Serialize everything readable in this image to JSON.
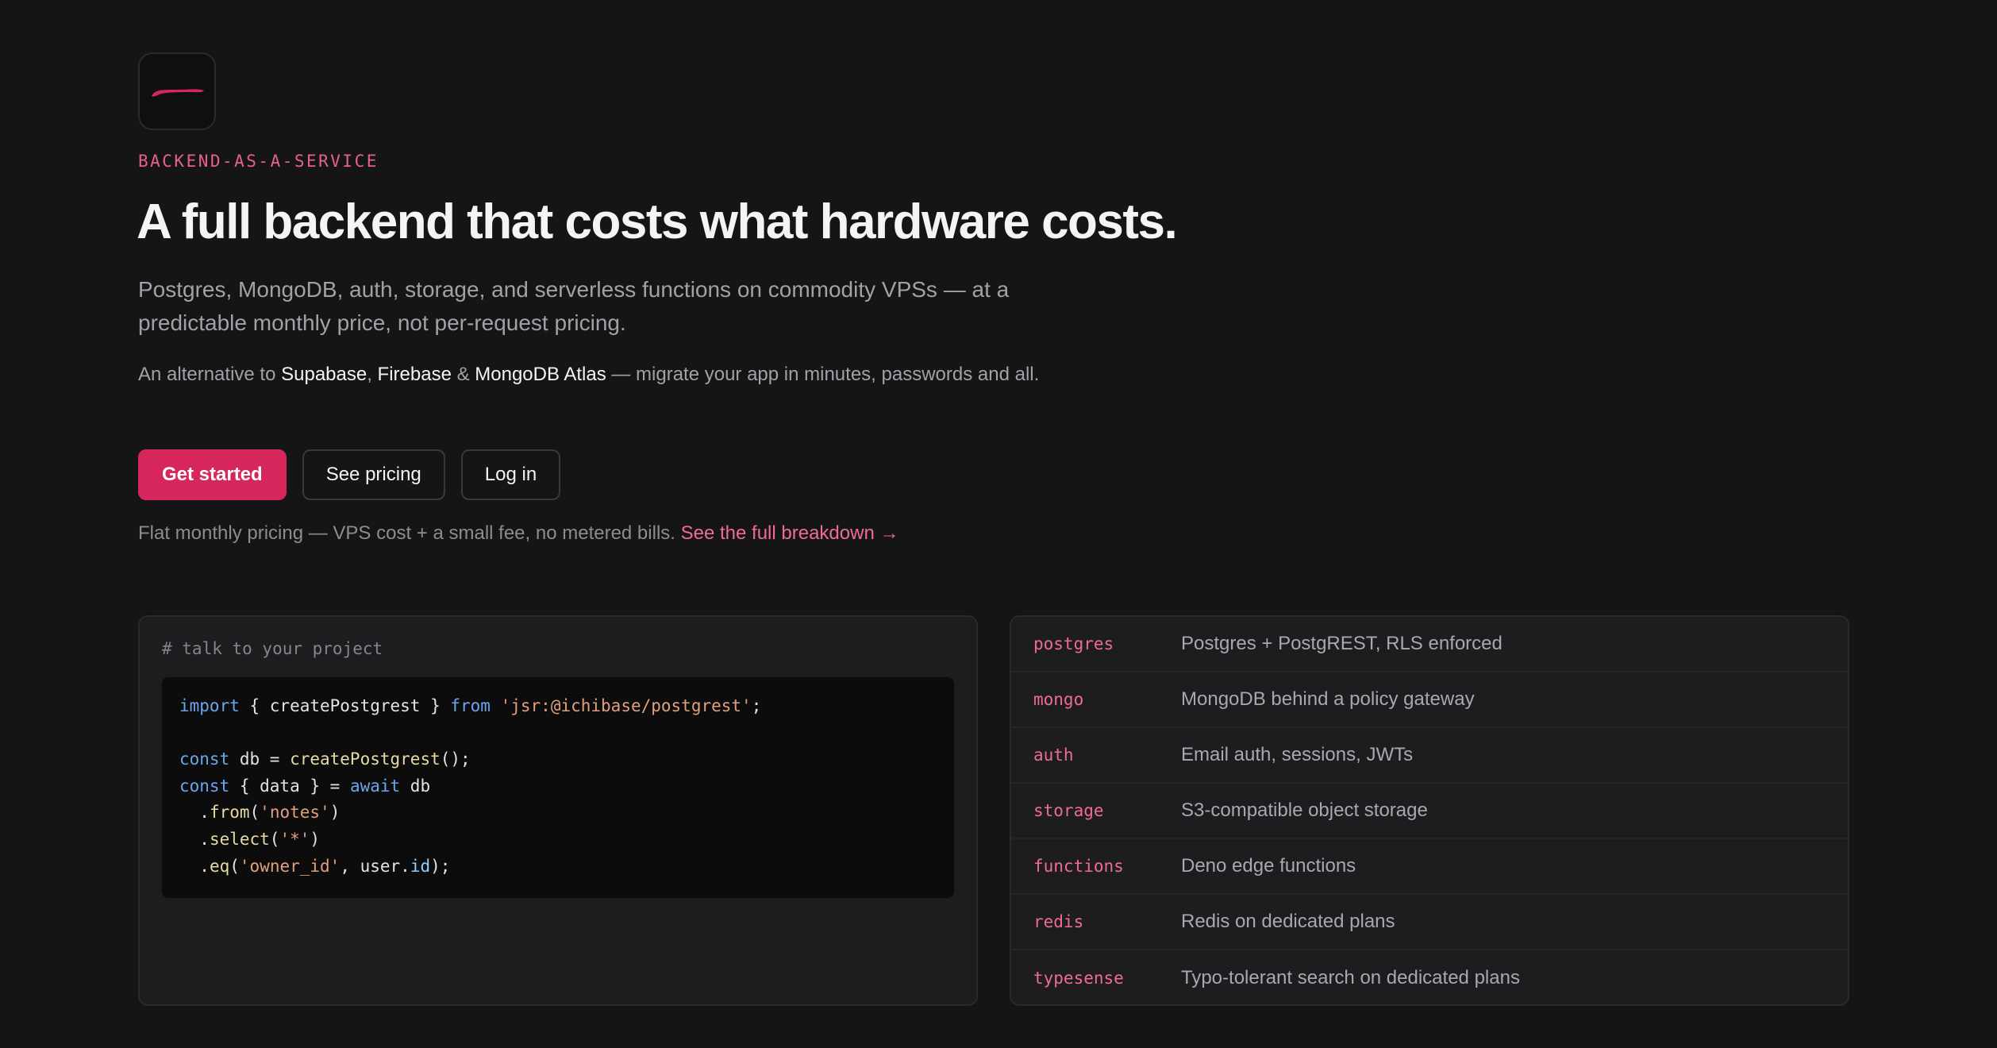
{
  "brand": {
    "logo_icon": "pink-brushstroke-logo",
    "accent": "#d6265c"
  },
  "hero": {
    "eyebrow": "BACKEND-AS-A-SERVICE",
    "headline": "A full backend that costs what hardware costs.",
    "lede": "Postgres, MongoDB, auth, storage, and serverless functions on commodity VPSs — at a predictable monthly price, not per-request pricing.",
    "alt": {
      "prefix": "An alternative to ",
      "supabase": "Supabase",
      "sep1": ", ",
      "firebase": "Firebase",
      "sep2": " & ",
      "mongodb_atlas": "MongoDB Atlas",
      "suffix": " — migrate your app in minutes, passwords and all."
    }
  },
  "actions": {
    "get_started": "Get started",
    "see_pricing": "See pricing",
    "log_in": "Log in"
  },
  "pricing_note": {
    "text": "Flat monthly pricing — VPS cost + a small fee, no metered bills. ",
    "link": "See the full breakdown →"
  },
  "code": {
    "comment": "# talk to your project",
    "lines": [
      [
        {
          "t": "import",
          "c": "kw"
        },
        {
          "t": " { createPostgrest } "
        },
        {
          "t": "from",
          "c": "kw"
        },
        {
          "t": " "
        },
        {
          "t": "'jsr:@ichibase/postgrest'",
          "c": "str"
        },
        {
          "t": ";"
        }
      ],
      [],
      [
        {
          "t": "const",
          "c": "kw"
        },
        {
          "t": " db = "
        },
        {
          "t": "createPostgrest",
          "c": "fn"
        },
        {
          "t": "();"
        }
      ],
      [
        {
          "t": "const",
          "c": "kw"
        },
        {
          "t": " { data } = "
        },
        {
          "t": "await",
          "c": "kw"
        },
        {
          "t": " db"
        }
      ],
      [
        {
          "t": "  ."
        },
        {
          "t": "from",
          "c": "fn"
        },
        {
          "t": "("
        },
        {
          "t": "'notes'",
          "c": "str"
        },
        {
          "t": ")"
        }
      ],
      [
        {
          "t": "  ."
        },
        {
          "t": "select",
          "c": "fn"
        },
        {
          "t": "("
        },
        {
          "t": "'*'",
          "c": "str"
        },
        {
          "t": ")"
        }
      ],
      [
        {
          "t": "  ."
        },
        {
          "t": "eq",
          "c": "fn"
        },
        {
          "t": "("
        },
        {
          "t": "'owner_id'",
          "c": "str"
        },
        {
          "t": ", user."
        },
        {
          "t": "id",
          "c": "prop"
        },
        {
          "t": ");"
        }
      ]
    ]
  },
  "services": [
    {
      "name": "postgres",
      "desc": "Postgres + PostgREST, RLS enforced"
    },
    {
      "name": "mongo",
      "desc": "MongoDB behind a policy gateway"
    },
    {
      "name": "auth",
      "desc": "Email auth, sessions, JWTs"
    },
    {
      "name": "storage",
      "desc": "S3-compatible object storage"
    },
    {
      "name": "functions",
      "desc": "Deno edge functions"
    },
    {
      "name": "redis",
      "desc": "Redis on dedicated plans"
    },
    {
      "name": "typesense",
      "desc": "Typo-tolerant search on dedicated plans"
    }
  ]
}
